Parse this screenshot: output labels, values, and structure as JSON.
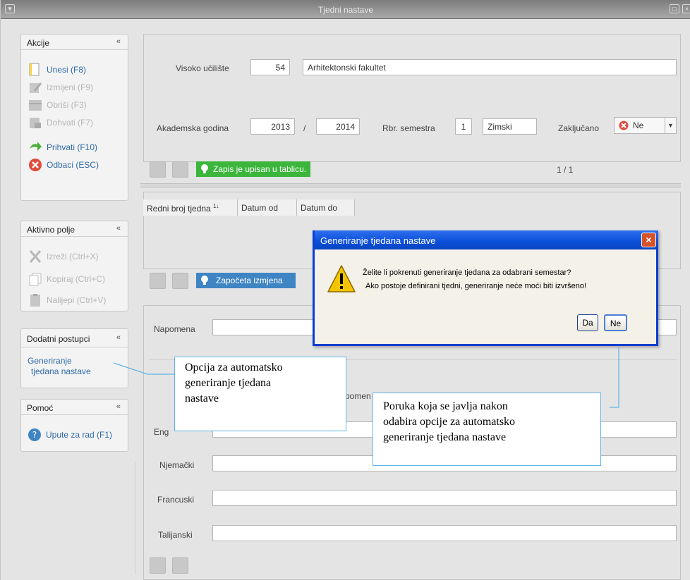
{
  "window": {
    "title": "Tjedni nastave"
  },
  "sidebar": {
    "akcije": {
      "title": "Akcije",
      "items": [
        {
          "label": "Unesi (F8)",
          "icon": "document-new-icon",
          "enabled": true
        },
        {
          "label": "Izmijeni (F9)",
          "icon": "edit-icon",
          "enabled": false
        },
        {
          "label": "Obriši (F3)",
          "icon": "delete-icon",
          "enabled": false
        },
        {
          "label": "Dohvati (F7)",
          "icon": "fetch-icon",
          "enabled": false
        },
        {
          "label": "Prihvati (F10)",
          "icon": "accept-arrow-icon",
          "enabled": true
        },
        {
          "label": "Odbaci (ESC)",
          "icon": "cancel-icon",
          "enabled": true
        }
      ]
    },
    "aktivno_polje": {
      "title": "Aktivno polje",
      "items": [
        {
          "label": "Izreži (Ctrl+X)",
          "icon": "scissors-icon",
          "enabled": false
        },
        {
          "label": "Kopiraj (Ctrl+C)",
          "icon": "copy-icon",
          "enabled": false
        },
        {
          "label": "Nalijepi (Ctrl+V)",
          "icon": "paste-icon",
          "enabled": false
        }
      ]
    },
    "dodatni": {
      "title": "Dodatni postupci",
      "link_line1": "Generiranje",
      "link_line2": "tjedana nastave"
    },
    "pomoc": {
      "title": "Pomoć",
      "item": "Upute za rad (F1)"
    }
  },
  "form": {
    "visoko_uciliste_label": "Visoko učilište",
    "visoko_uciliste_code": "54",
    "visoko_uciliste_name": "Arhitektonski fakultet",
    "akademska_godina_label": "Akademska godina",
    "year_from": "2013",
    "year_sep": "/",
    "year_to": "2014",
    "semestar_label": "Rbr. semestra",
    "semestar_no": "1",
    "semestar_name": "Zimski",
    "zakljucano_label": "Zaključano",
    "zakljucano_value": "Ne",
    "status_text": "Zapis je upisan u tablicu.",
    "pager": "1 / 1"
  },
  "table": {
    "columns": [
      "Redni broj tjedna",
      "Datum od",
      "Datum do"
    ],
    "sort_marker": "1↓",
    "status_text": "Započeta izmjena"
  },
  "notes": {
    "napomena_label": "Napomena",
    "partial_label": "pomen",
    "partial_label2": "Eng",
    "partial_label3": "nom",
    "njemacki_label": "Njemački",
    "francuski_label": "Francuski",
    "talijanski_label": "Talijanski"
  },
  "dialog": {
    "title": "Generiranje tjedana nastave",
    "line1": "Želite li pokrenuti generiranje tjedana za odabrani semestar?",
    "line2": "Ako postoje definirani tjedni, generiranje neće moći biti izvršeno!",
    "yes": "Da",
    "no": "Ne"
  },
  "callouts": {
    "left": [
      "Opcija za automatsko",
      "generiranje tjedana",
      "nastave"
    ],
    "right": [
      "Poruka koja se javlja nakon",
      "odabira opcije za automatsko",
      "generiranje tjedana nastave"
    ]
  },
  "colors": {
    "accent_blue": "#2e6aa8",
    "status_green": "#3bb53b",
    "status_blue": "#3f85c4",
    "dialog_title": "#0b4fd8",
    "callout_border": "#5fb3e6"
  }
}
